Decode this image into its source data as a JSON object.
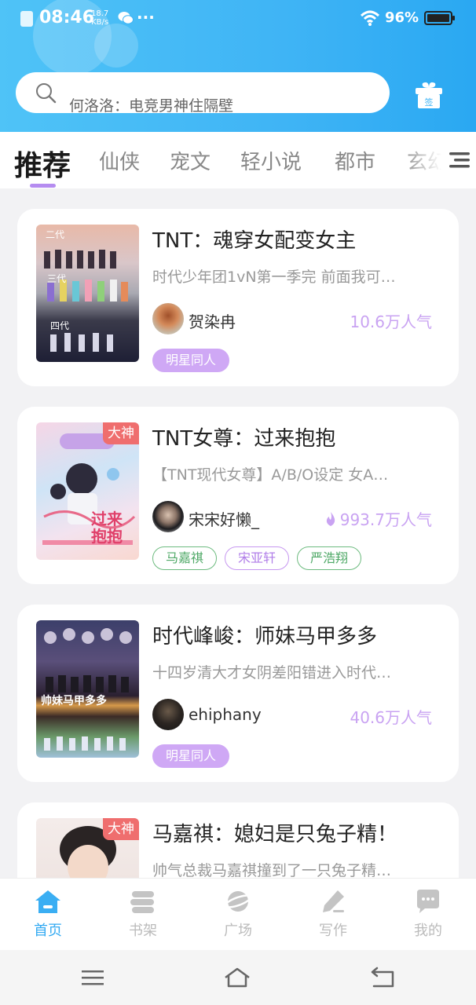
{
  "status_bar": {
    "time": "08:46",
    "net_speed": "18.7",
    "net_unit": "KB/s",
    "battery": "96%",
    "more": "···",
    "icons": [
      "sim-icon",
      "wechat-icon",
      "wifi-icon",
      "battery-icon"
    ]
  },
  "header": {
    "search_placeholder": "何洛洛：电竞男神住隔壁",
    "gift_label": "签"
  },
  "tabs": [
    "推荐",
    "仙侠",
    "宠文",
    "轻小说",
    "都市",
    "玄幻"
  ],
  "active_tab": "推荐",
  "books": [
    {
      "title": "TNT：魂穿女配变女主",
      "desc": "时代少年团1vN第一季完 前面我可…",
      "author": "贺染冉",
      "popularity": "10.6万人气",
      "hot": false,
      "badge": "",
      "cover_text": [
        "二代",
        "三代",
        "四代"
      ],
      "tags": [
        "明星同人"
      ]
    },
    {
      "title": "TNT女尊：过来抱抱",
      "desc": "【TNT现代女尊】A/B/O设定  女A…",
      "author": "宋宋好懒_",
      "popularity": "993.7万人气",
      "hot": true,
      "badge": "大神",
      "cover_text": [
        "过来抱抱"
      ],
      "tags": [
        "马嘉祺",
        "宋亚轩",
        "严浩翔"
      ]
    },
    {
      "title": "时代峰峻：师妹马甲多多",
      "desc": "十四岁清大才女阴差阳错进入时代…",
      "author": "ehiphany",
      "popularity": "40.6万人气",
      "hot": false,
      "badge": "",
      "cover_text": [
        "帅妹马甲多多"
      ],
      "tags": [
        "明星同人"
      ]
    },
    {
      "title": "马嘉祺：媳妇是只兔子精！",
      "desc": "帅气总裁马嘉祺撞到了一只兔子精…",
      "author": "",
      "popularity": "",
      "hot": false,
      "badge": "大神",
      "cover_text": [],
      "tags": []
    }
  ],
  "bottom_nav": [
    {
      "label": "首页",
      "icon": "home-icon",
      "active": true
    },
    {
      "label": "书架",
      "icon": "bookshelf-icon",
      "active": false
    },
    {
      "label": "广场",
      "icon": "planet-icon",
      "active": false
    },
    {
      "label": "写作",
      "icon": "pencil-icon",
      "active": false
    },
    {
      "label": "我的",
      "icon": "chat-bubble-icon",
      "active": false
    }
  ],
  "colors": {
    "header_blue": "#3fb4f5",
    "accent_purple": "#b58cf0",
    "popularity_purple": "#c9a3f2",
    "badge_red": "#ef6e6e",
    "nav_active": "#33aaf2"
  }
}
